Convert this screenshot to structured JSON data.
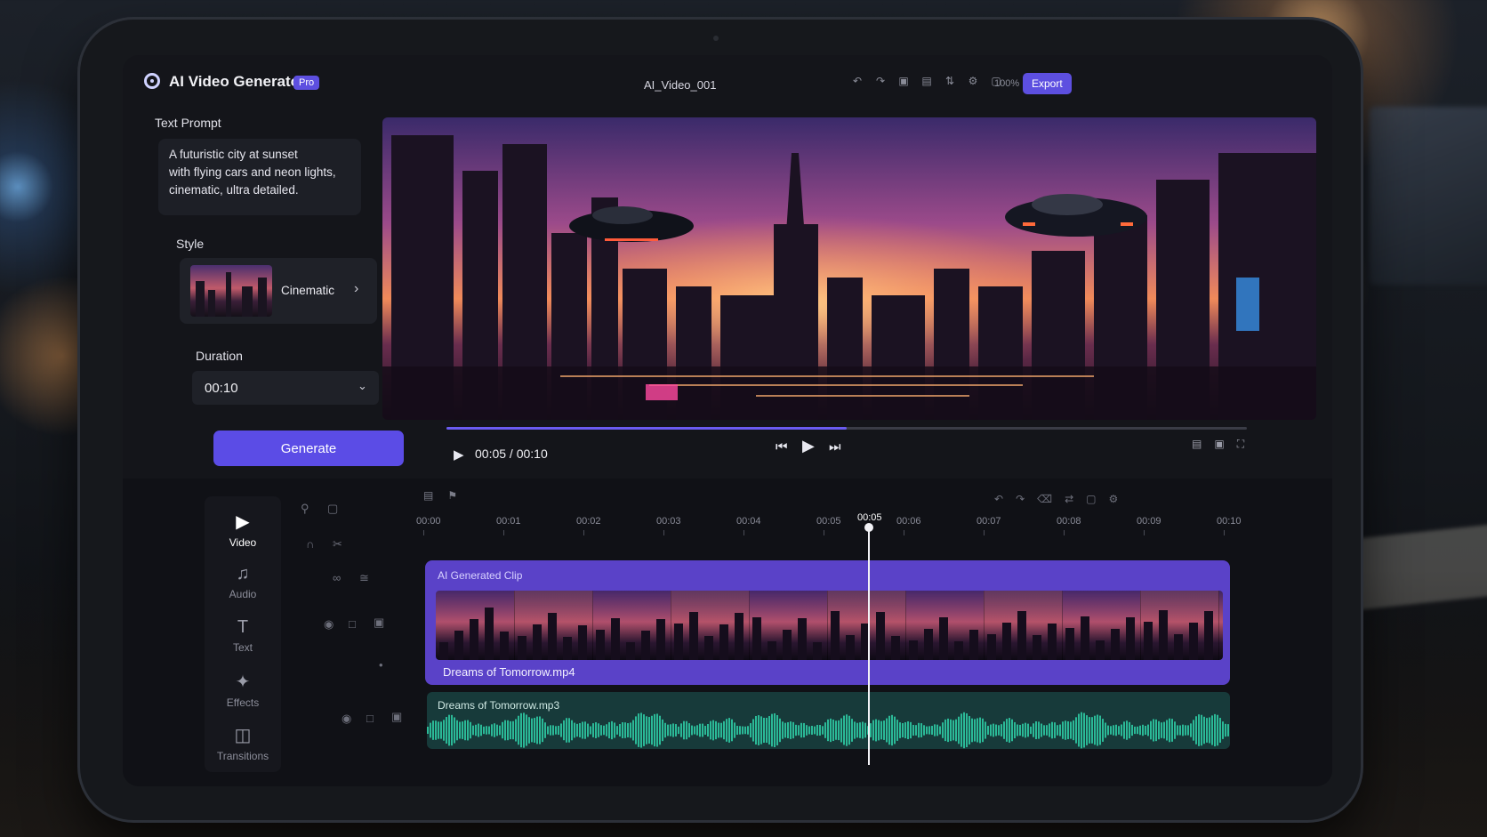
{
  "app": {
    "title": "AI Video Generator",
    "badge": "Pro",
    "file_name": "AI_Video_001"
  },
  "toolbar": {
    "icons": [
      "undo-icon",
      "redo-icon",
      "crop-icon",
      "layers-icon",
      "split-icon",
      "settings-icon",
      "fit-icon"
    ],
    "zoom": "100%",
    "export_label": "Export"
  },
  "left_panel": {
    "prompt_label": "Text Prompt",
    "prompt_lines": [
      "A futuristic city at sunset",
      "with flying cars and neon lights,",
      "cinematic, ultra detailed."
    ],
    "style_label": "Style",
    "style_value": "Cinematic",
    "duration_label": "Duration",
    "duration_value": "00:10",
    "generate_label": "Generate"
  },
  "player": {
    "current_time": "00:05",
    "separator": "/",
    "total_time": "00:10",
    "time_text": "00:05 / 00:10",
    "progress": 0.5
  },
  "tools": [
    {
      "name": "video",
      "label": "Video",
      "active": true
    },
    {
      "name": "audio",
      "label": "Audio",
      "active": false
    },
    {
      "name": "text",
      "label": "Text",
      "active": false
    },
    {
      "name": "effects",
      "label": "Effects",
      "active": false
    },
    {
      "name": "transitions",
      "label": "Transitions",
      "active": false
    }
  ],
  "timeline": {
    "ticks": [
      "00:00",
      "00:01",
      "00:02",
      "00:03",
      "00:04",
      "00:05",
      "00:06",
      "00:07",
      "00:08",
      "00:09",
      "00:10"
    ],
    "playhead_time": "00:05",
    "video_clip_label": "AI Generated Clip",
    "video_clip_subtitle": "Dreams of Tomorrow.mp4",
    "audio_clip_label": "Dreams of Tomorrow.mp3"
  },
  "colors": {
    "accent": "#5b4ce6",
    "audio_wave": "#2fd0a8",
    "clip": "#5a42c8"
  }
}
